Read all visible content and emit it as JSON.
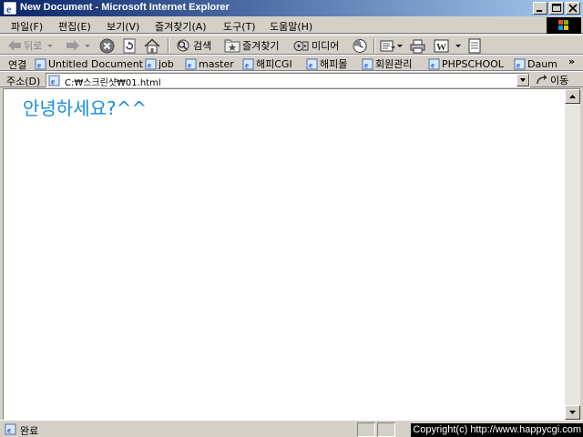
{
  "window": {
    "title": "New Document - Microsoft Internet Explorer"
  },
  "menu": [
    {
      "label": "파일(F)"
    },
    {
      "label": "편집(E)"
    },
    {
      "label": "보기(V)"
    },
    {
      "label": "즐겨찾기(A)"
    },
    {
      "label": "도구(T)"
    },
    {
      "label": "도움말(H)"
    }
  ],
  "toolbar": {
    "back": "뒤로",
    "search": "검색",
    "favorites": "즐겨찾기",
    "media": "미디어"
  },
  "links": {
    "label": "연결",
    "items": [
      {
        "label": "Untitled Document"
      },
      {
        "label": "job"
      },
      {
        "label": "master"
      },
      {
        "label": "해피CGI"
      },
      {
        "label": "해피몰"
      },
      {
        "label": "회원관리"
      },
      {
        "label": "PHPSCHOOL"
      },
      {
        "label": "Daum"
      }
    ],
    "more": "»"
  },
  "address": {
    "label": "주소(D)",
    "value": "C:₩스크린샷₩01.html",
    "go": "이동"
  },
  "page": {
    "text": "안녕하세요?^^"
  },
  "status": {
    "text": "완료"
  },
  "overlay": {
    "copyright": "Copyright(c) http://www.happycgi.com"
  },
  "colors": {
    "title_gradient_start": "#0a246a",
    "title_gradient_end": "#a6caf0",
    "page_text": "#1a8ed8"
  }
}
